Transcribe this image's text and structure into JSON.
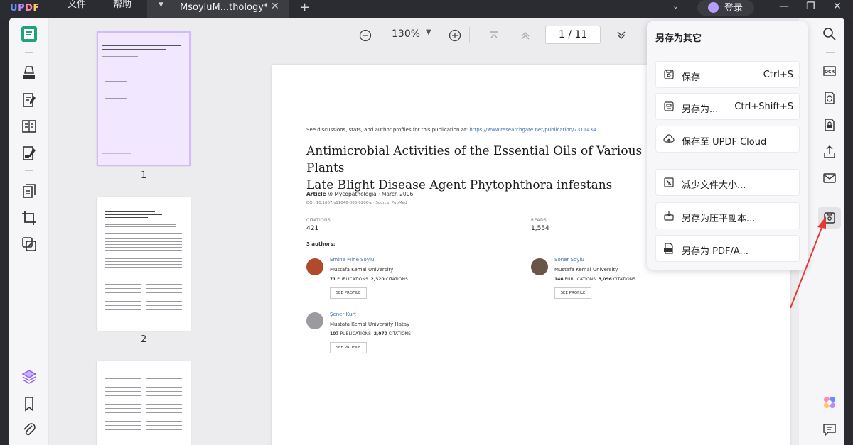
{
  "app": {
    "logo": "UPDF",
    "menu": [
      "文件",
      "帮助"
    ],
    "tab_title": "MsoyluM...thology*",
    "login_label": "登录"
  },
  "toolbar": {
    "zoom": "130%",
    "page_current": "1",
    "page_sep": "/",
    "page_total": "11"
  },
  "thumbnails": {
    "pages": [
      "1",
      "2"
    ]
  },
  "document": {
    "header_text": "See discussions, stats, and author profiles for this publication at:",
    "header_link": "https://www.researchgate.net/publication/7311434",
    "title_line1": "Antimicrobial Activities of the Essential Oils of Various Plants",
    "title_line2": "Late Blight Disease Agent Phytophthora infestans",
    "article_label": "Article",
    "article_in": "in",
    "journal": "Mycopathologia · March 2006",
    "doi": "DOI: 10.1007/s11046-005-0206-z · Source: PubMed",
    "citations_label": "CITATIONS",
    "citations_value": "421",
    "reads_label": "READS",
    "reads_value": "1,554",
    "authors_heading": "3 authors:",
    "authors": [
      {
        "name": "Emine Mine Soylu",
        "uni": "Mustafa Kemal University",
        "pubs": "71",
        "pubs_label": "PUBLICATIONS",
        "cites": "2,320",
        "cites_label": "CITATIONS",
        "button": "SEE PROFILE"
      },
      {
        "name": "Soner Soylu",
        "uni": "Mustafa Kemal University",
        "pubs": "146",
        "pubs_label": "PUBLICATIONS",
        "cites": "3,096",
        "cites_label": "CITATIONS",
        "button": "SEE PROFILE"
      },
      {
        "name": "Şener Kurt",
        "uni": "Mustafa Kemal University Hatay",
        "pubs": "107",
        "pubs_label": "PUBLICATIONS",
        "cites": "2,070",
        "cites_label": "CITATIONS",
        "button": "SEE PROFILE"
      }
    ]
  },
  "save_menu": {
    "title": "另存为其它",
    "items": [
      {
        "label": "保存",
        "shortcut": "Ctrl+S",
        "icon": "save-icon"
      },
      {
        "label": "另存为...",
        "shortcut": "Ctrl+Shift+S",
        "icon": "save-as-icon"
      },
      {
        "label": "保存至 UPDF Cloud",
        "shortcut": "",
        "icon": "cloud-icon"
      },
      {
        "label": "减少文件大小...",
        "shortcut": "",
        "icon": "compress-icon"
      },
      {
        "label": "另存为压平副本...",
        "shortcut": "",
        "icon": "flatten-icon"
      },
      {
        "label": "另存为 PDF/A...",
        "shortcut": "",
        "icon": "pdfa-icon"
      }
    ]
  },
  "colors": {
    "accent": "#8b5cf6",
    "annotation_arrow": "#e53935"
  }
}
